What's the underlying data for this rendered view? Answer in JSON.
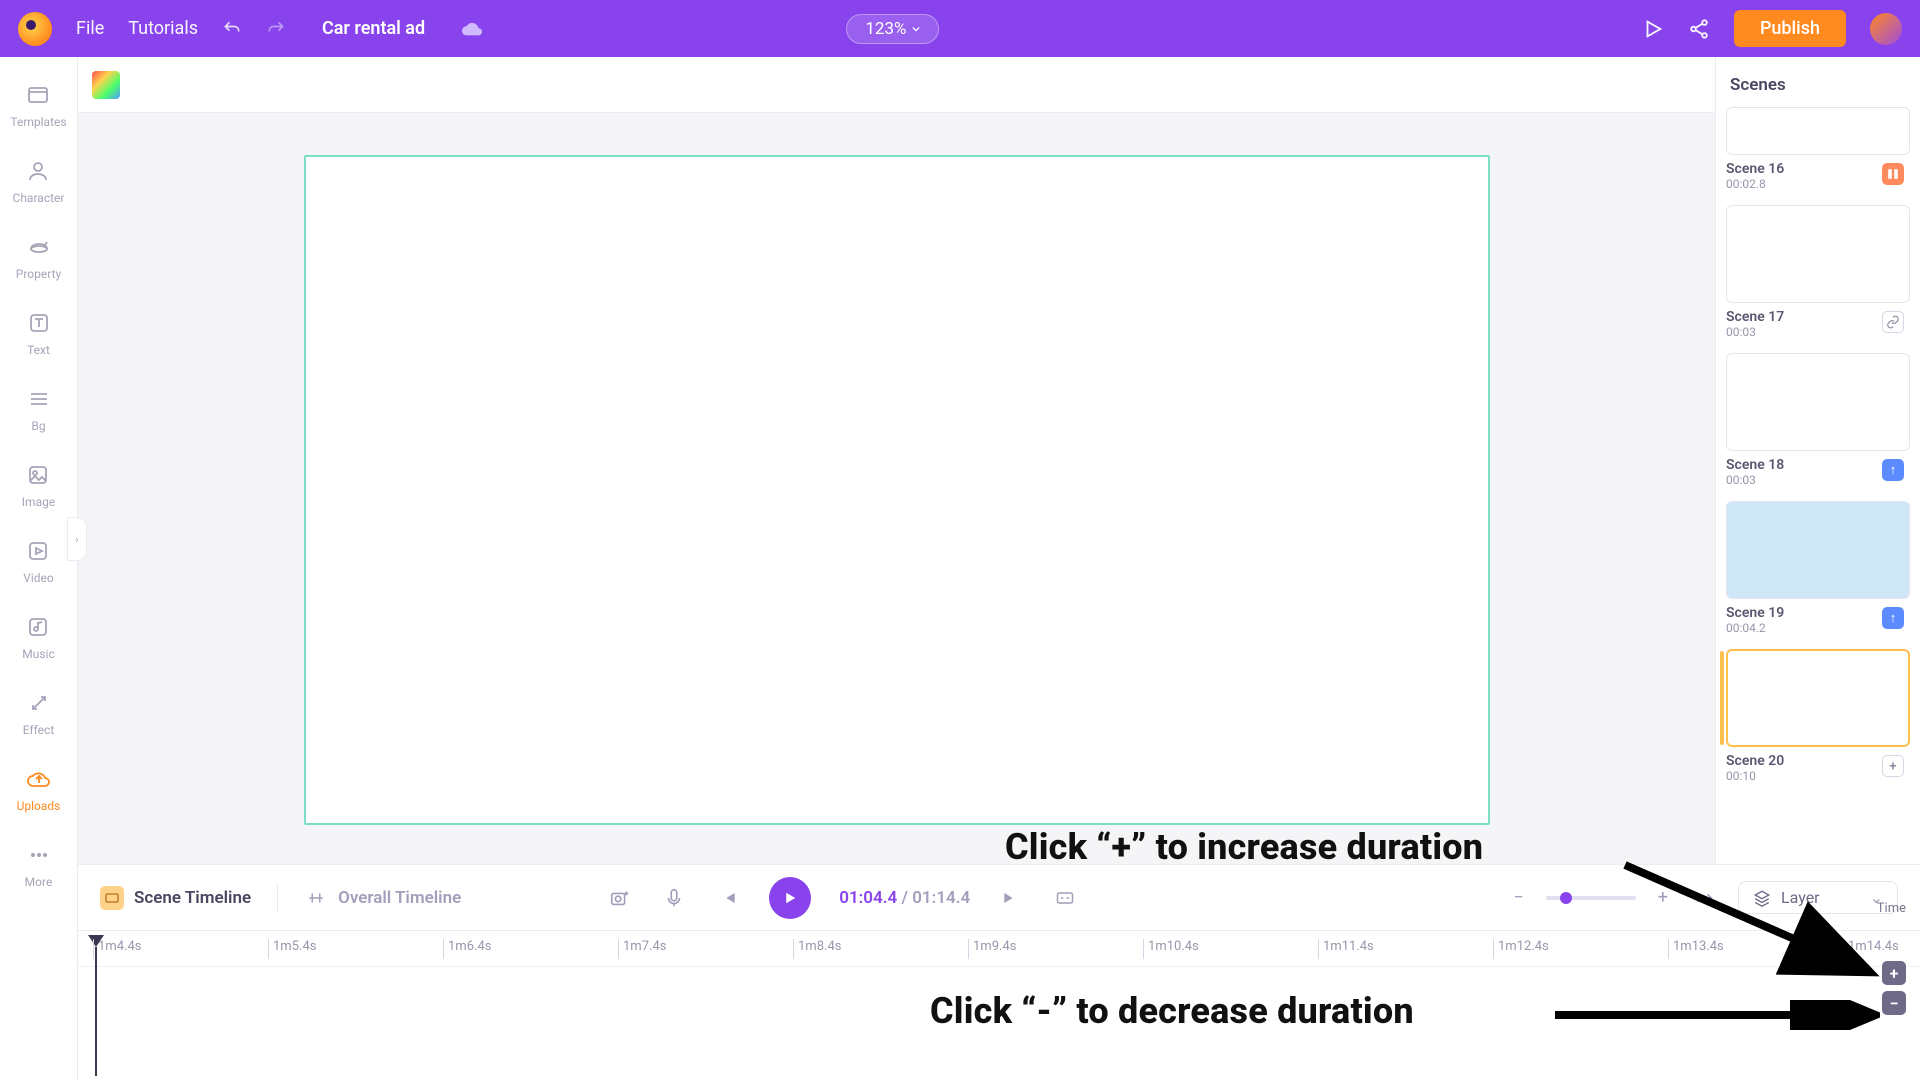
{
  "topbar": {
    "file": "File",
    "tutorials": "Tutorials",
    "project_title": "Car rental ad",
    "zoom": "123%",
    "publish": "Publish"
  },
  "sidebar": {
    "items": [
      {
        "label": "Templates"
      },
      {
        "label": "Character"
      },
      {
        "label": "Property"
      },
      {
        "label": "Text"
      },
      {
        "label": "Bg"
      },
      {
        "label": "Image"
      },
      {
        "label": "Video"
      },
      {
        "label": "Music"
      },
      {
        "label": "Effect"
      },
      {
        "label": "Uploads"
      },
      {
        "label": "More"
      }
    ]
  },
  "scenes": {
    "header": "Scenes",
    "list": [
      {
        "title": "Scene 16",
        "dur": "00:02.8"
      },
      {
        "title": "Scene 17",
        "dur": "00:03"
      },
      {
        "title": "Scene 18",
        "dur": "00:03"
      },
      {
        "title": "Scene 19",
        "dur": "00:04.2"
      },
      {
        "title": "Scene 20",
        "dur": "00:10"
      }
    ]
  },
  "timeline": {
    "scene_tab": "Scene Timeline",
    "overall_tab": "Overall Timeline",
    "current": "01:04.4",
    "total": "01:14.4",
    "layer_label": "Layer",
    "time_label": "Time",
    "plus": "+",
    "minus": "−",
    "ticks": [
      "1m4.4s",
      "1m5.4s",
      "1m6.4s",
      "1m7.4s",
      "1m8.4s",
      "1m9.4s",
      "1m10.4s",
      "1m11.4s",
      "1m12.4s",
      "1m13.4s",
      "1m14.4s"
    ]
  },
  "annotations": {
    "increase": "Click “+” to increase duration",
    "decrease": "Click “-” to decrease duration"
  }
}
